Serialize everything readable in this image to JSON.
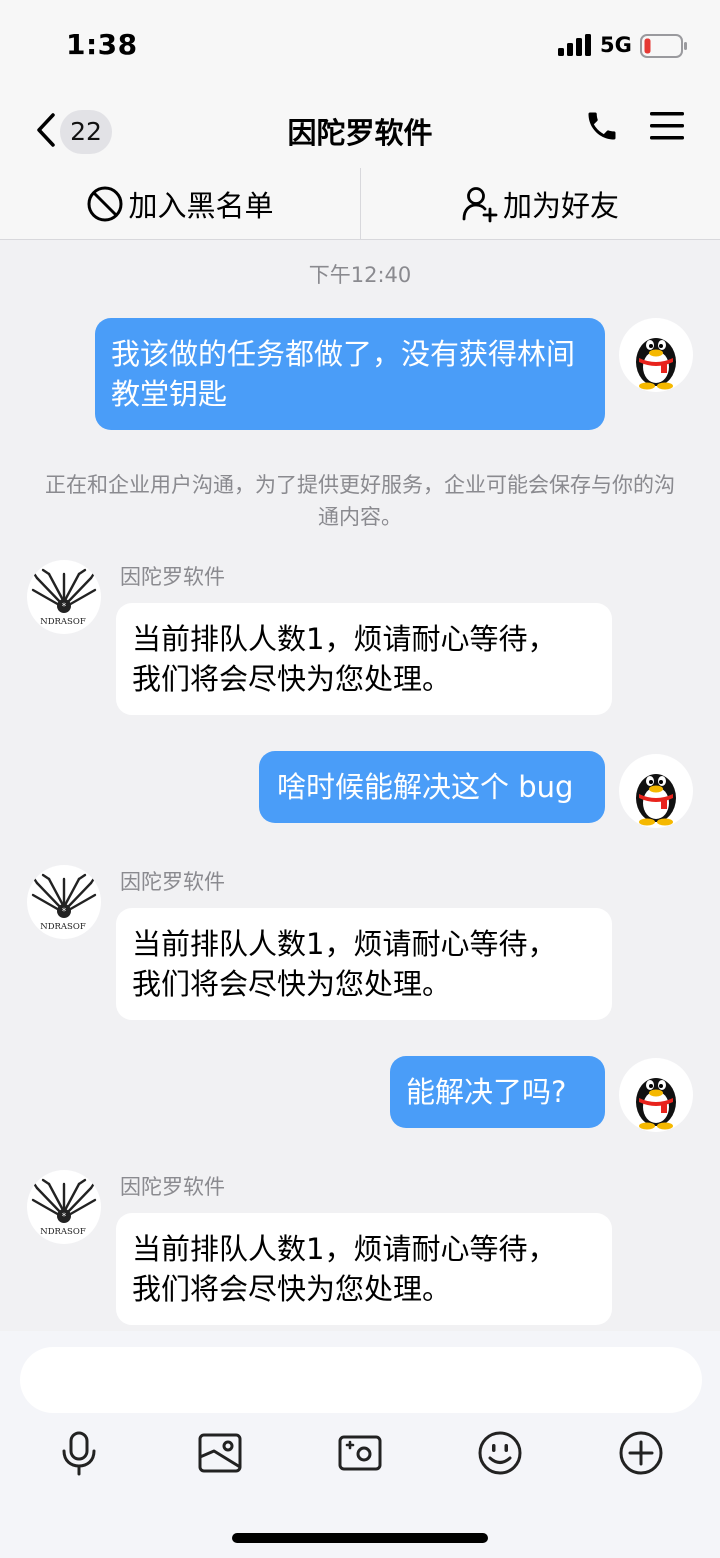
{
  "status_bar": {
    "time": "1:38",
    "network": "5G"
  },
  "nav": {
    "unread_count": "22",
    "title": "因陀罗软件"
  },
  "actions": {
    "blacklist": "加入黑名单",
    "add_friend": "加为好友"
  },
  "chat": {
    "timestamp": "下午12:40",
    "notice": "正在和企业用户沟通，为了提供更好服务，企业可能会保存与你的沟通内容。",
    "messages": [
      {
        "sender": "me",
        "text": "我该做的任务都做了，没有获得林间教堂钥匙"
      },
      {
        "sender": "因陀罗软件",
        "text_line1": "当前排队人数1，烦请耐心等待，",
        "text_line2": "我们将会尽快为您处理。"
      },
      {
        "sender": "me",
        "text": "啥时候能解决这个 bug"
      },
      {
        "sender": "因陀罗软件",
        "text_line1": "当前排队人数1，烦请耐心等待，",
        "text_line2": "我们将会尽快为您处理。"
      },
      {
        "sender": "me",
        "text": "能解决了吗?"
      },
      {
        "sender": "因陀罗软件",
        "text_line1": "当前排队人数1，烦请耐心等待，",
        "text_line2": "我们将会尽快为您处理。"
      }
    ]
  },
  "input": {
    "placeholder": ""
  },
  "colors": {
    "outgoing_bubble": "#4a9df8",
    "incoming_bubble": "#ffffff",
    "background": "#f1f1f3",
    "battery_low": "#e53935"
  },
  "icons": [
    "chevron-left-icon",
    "phone-icon",
    "menu-icon",
    "block-icon",
    "add-friend-icon",
    "mic-icon",
    "image-icon",
    "camera-icon",
    "emoji-icon",
    "plus-icon"
  ]
}
